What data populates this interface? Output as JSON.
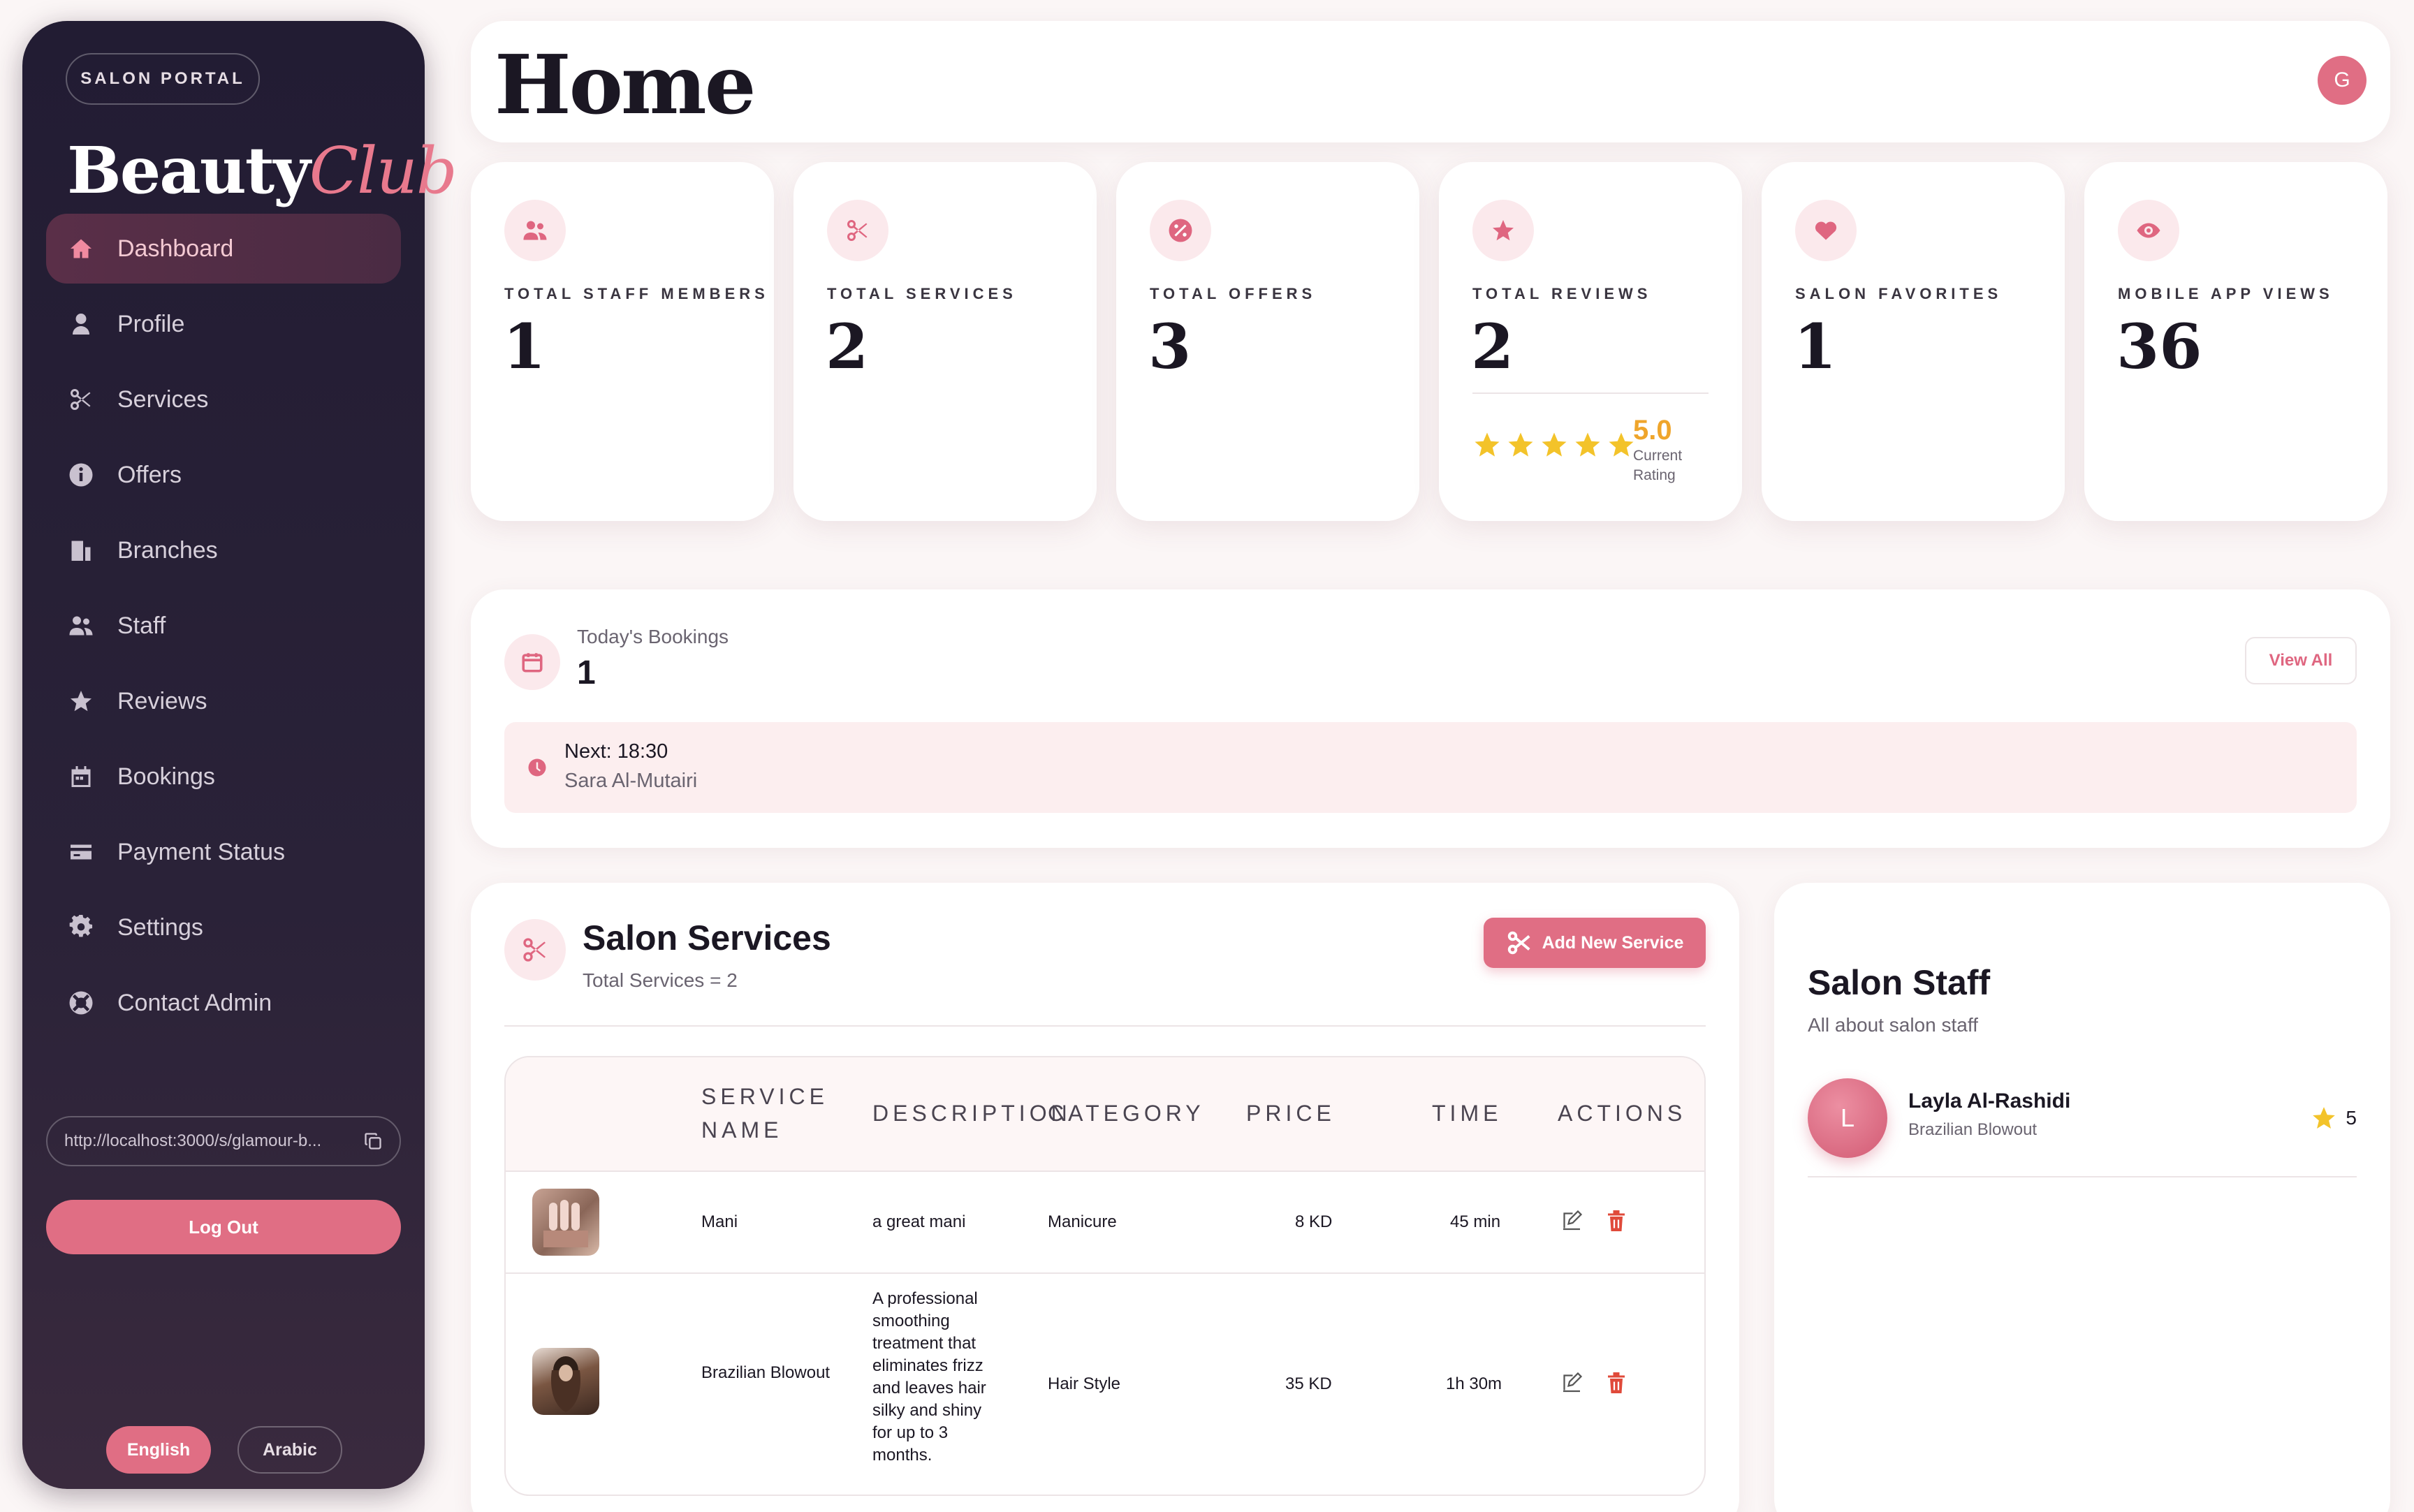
{
  "sidebar": {
    "badge": "SALON PORTAL",
    "logo_part1": "Beauty",
    "logo_part2": "Club",
    "items": [
      {
        "label": "Dashboard",
        "icon": "home-icon"
      },
      {
        "label": "Profile",
        "icon": "person-icon"
      },
      {
        "label": "Services",
        "icon": "scissors-icon"
      },
      {
        "label": "Offers",
        "icon": "info-icon"
      },
      {
        "label": "Branches",
        "icon": "building-icon"
      },
      {
        "label": "Staff",
        "icon": "users-icon"
      },
      {
        "label": "Reviews",
        "icon": "star-icon"
      },
      {
        "label": "Bookings",
        "icon": "calendar-icon"
      },
      {
        "label": "Payment Status",
        "icon": "credit-card-icon"
      },
      {
        "label": "Settings",
        "icon": "gear-icon"
      },
      {
        "label": "Contact Admin",
        "icon": "support-icon"
      }
    ],
    "url": "http://localhost:3000/s/glamour-b...",
    "logout_label": "Log Out",
    "lang_english": "English",
    "lang_arabic": "Arabic"
  },
  "header": {
    "title": "Home",
    "avatar_initial": "G"
  },
  "stats": [
    {
      "label": "TOTAL STAFF MEMBERS",
      "value": "1",
      "icon": "users-icon"
    },
    {
      "label": "TOTAL SERVICES",
      "value": "2",
      "icon": "scissors-icon"
    },
    {
      "label": "TOTAL OFFERS",
      "value": "3",
      "icon": "percent-icon"
    },
    {
      "label": "TOTAL REVIEWS",
      "value": "2",
      "icon": "star-icon",
      "rating": "5.0",
      "rating_caption": "Current Rating",
      "stars": 5
    },
    {
      "label": "SALON FAVORITES",
      "value": "1",
      "icon": "heart-icon"
    },
    {
      "label": "MOBILE APP VIEWS",
      "value": "36",
      "icon": "eye-icon"
    }
  ],
  "bookings": {
    "title": "Today's Bookings",
    "count": "1",
    "view_all": "View All",
    "next_time": "Next: 18:30",
    "next_client": "Sara Al-Mutairi"
  },
  "services": {
    "title": "Salon Services",
    "subtitle": "Total Services = 2",
    "add_button": "Add New Service",
    "columns": [
      "SERVICE NAME",
      "DESCRIPTION",
      "CATEGORY",
      "PRICE",
      "TIME",
      "ACTIONS"
    ],
    "rows": [
      {
        "name": "Mani",
        "description": "a great mani",
        "category": "Manicure",
        "price": "8 KD",
        "time": "45 min"
      },
      {
        "name": "Brazilian Blowout",
        "description": "A professional smoothing treatment that eliminates frizz and leaves hair silky and shiny for up to 3 months.",
        "category": "Hair Style",
        "price": "35 KD",
        "time": "1h 30m"
      }
    ]
  },
  "staff": {
    "title": "Salon Staff",
    "subtitle": "All about salon staff",
    "members": [
      {
        "initial": "L",
        "name": "Layla Al-Rashidi",
        "role": "Brazilian Blowout",
        "rating": "5"
      }
    ]
  },
  "colors": {
    "accent": "#e06e84",
    "sidebar_bg": "#221c33",
    "star": "#f3c32a",
    "rating_text": "#efa52b",
    "delete": "#e04a3a"
  }
}
